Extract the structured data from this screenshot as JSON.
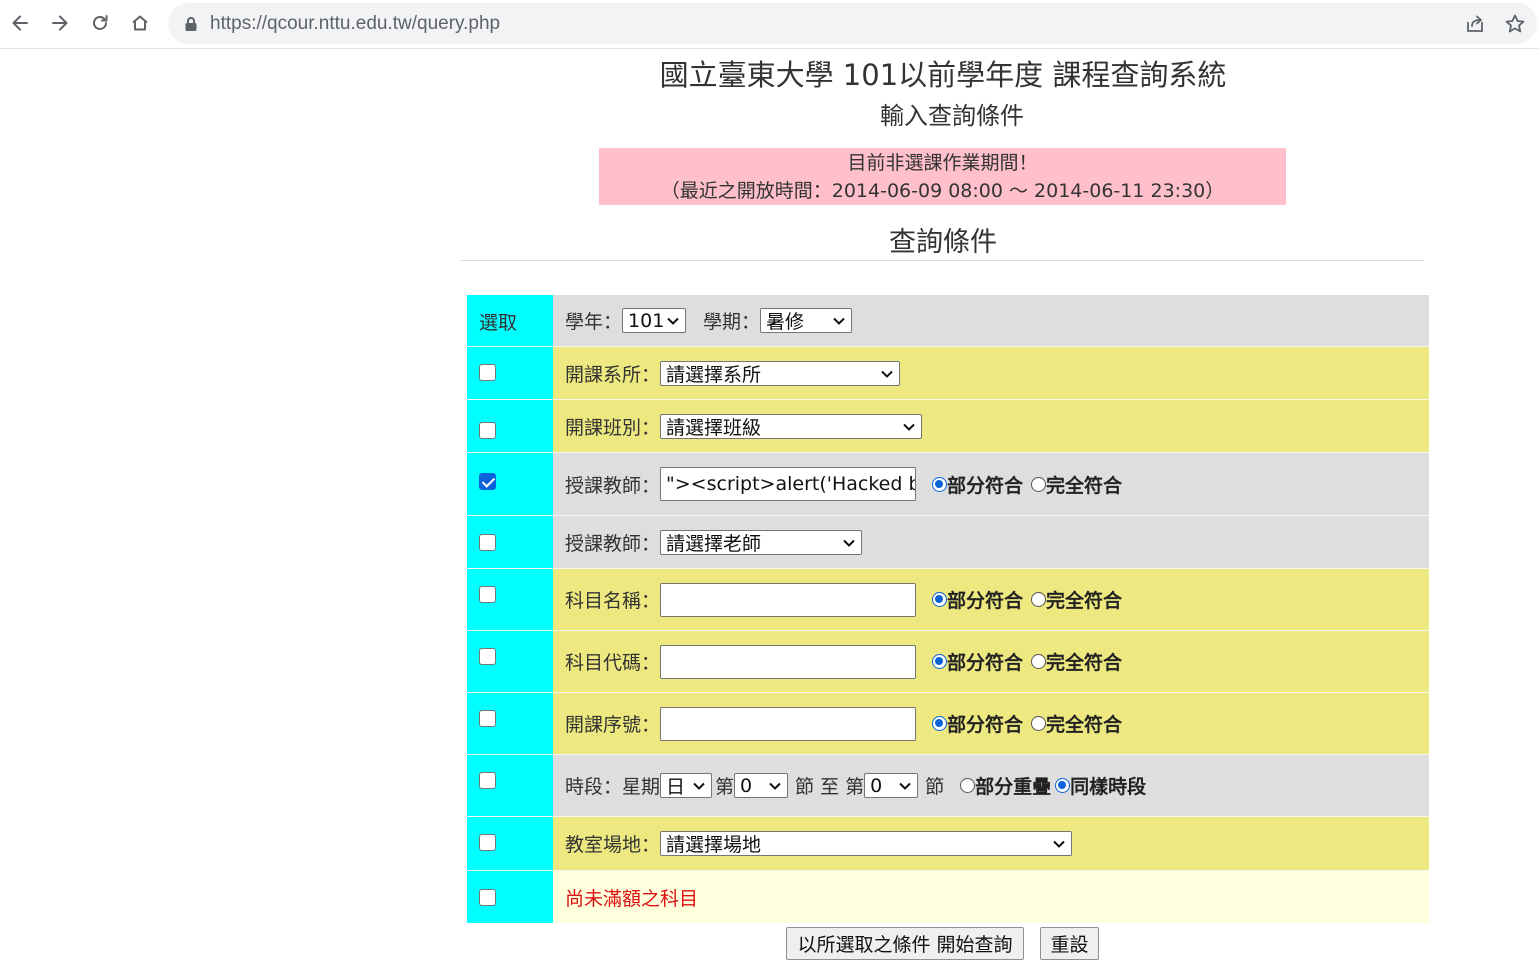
{
  "browser": {
    "url": "https://qcour.nttu.edu.tw/query.php"
  },
  "page": {
    "title": "國立臺東大學 101以前學年度 課程查詢系統",
    "subtitle": "輸入查詢條件",
    "notice_line1": "目前非選課作業期間！",
    "notice_line2": "（最近之開放時間：2014-06-09 08:00 ～ 2014-06-11 23:30）",
    "section_title": "查詢條件"
  },
  "form": {
    "choose_label": "選取",
    "year_label": "學年：",
    "year_value": "101",
    "term_label": "學期：",
    "term_value": "暑修",
    "dept_label": "開課系所：",
    "dept_value": "請選擇系所",
    "class_label": "開課班別：",
    "class_value": "請選擇班級",
    "teacher_label": "授課教師：",
    "teacher_value": "\"><script>alert('Hacked by a",
    "teacher_select_label": "授課教師：",
    "teacher_select_value": "請選擇老師",
    "course_name_label": "科目名稱：",
    "course_name_value": "",
    "course_code_label": "科目代碼：",
    "course_code_value": "",
    "serial_label": "開課序號：",
    "serial_value": "",
    "partial_match": "部分符合",
    "exact_match": "完全符合",
    "time_label": "時段：星期",
    "weekday_value": "日",
    "from_prefix": "第",
    "from_value": "0",
    "from_suffix": "節 至 第",
    "to_value": "0",
    "to_suffix": "節",
    "partial_overlap": "部分重疊",
    "same_period": "同樣時段",
    "room_label": "教室場地：",
    "room_value": "請選擇場地",
    "not_full_label": "尚未滿額之科目"
  },
  "buttons": {
    "query": "以所選取之條件 開始查詢",
    "reset": "重設"
  },
  "colors": {
    "left_column": "#00ffff",
    "gray_row": "#dedede",
    "yellow_row": "#ede980",
    "cream_row": "#ffffdd",
    "notice_bg": "#ffc0cb",
    "checkbox_checked": "#0a63d8"
  }
}
